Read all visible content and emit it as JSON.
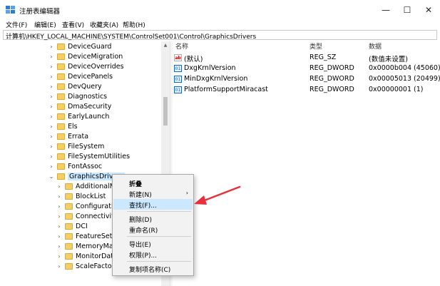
{
  "window": {
    "title": "注册表编辑器",
    "minimize": "—",
    "maximize": "☐",
    "close": "✕"
  },
  "menu": [
    "文件(F)",
    "编辑(E)",
    "查看(V)",
    "收藏夹(A)",
    "帮助(H)"
  ],
  "address": "计算机\\HKEY_LOCAL_MACHINE\\SYSTEM\\ControlSet001\\Control\\GraphicsDrivers",
  "tree": [
    {
      "label": "DeviceGuard",
      "level": 0
    },
    {
      "label": "DeviceMigration",
      "level": 0
    },
    {
      "label": "DeviceOverrides",
      "level": 0
    },
    {
      "label": "DevicePanels",
      "level": 0
    },
    {
      "label": "DevQuery",
      "level": 0
    },
    {
      "label": "Diagnostics",
      "level": 0
    },
    {
      "label": "DmaSecurity",
      "level": 0
    },
    {
      "label": "EarlyLaunch",
      "level": 0
    },
    {
      "label": "Els",
      "level": 0
    },
    {
      "label": "Errata",
      "level": 0
    },
    {
      "label": "FileSystem",
      "level": 0
    },
    {
      "label": "FileSystemUtilities",
      "level": 0
    },
    {
      "label": "FontAssoc",
      "level": 0
    },
    {
      "label": "GraphicsDrivers",
      "level": 0,
      "expanded": true,
      "selected": true
    },
    {
      "label": "AdditionalMo",
      "level": 1
    },
    {
      "label": "BlockList",
      "level": 1
    },
    {
      "label": "Configuration",
      "level": 1
    },
    {
      "label": "Connectivity",
      "level": 1
    },
    {
      "label": "DCI",
      "level": 1
    },
    {
      "label": "FeatureSetUs",
      "level": 1
    },
    {
      "label": "MemoryMan",
      "level": 1
    },
    {
      "label": "MonitorDataS",
      "level": 1
    },
    {
      "label": "ScaleFactors",
      "level": 1
    }
  ],
  "columns": {
    "name": "名称",
    "type": "类型",
    "data": "数据"
  },
  "values": [
    {
      "name": "(默认)",
      "type": "REG_SZ",
      "data": "(数值未设置)",
      "icon": "string-value-icon"
    },
    {
      "name": "DxgKrnlVersion",
      "type": "REG_DWORD",
      "data": "0x0000b004 (45060)",
      "icon": "binary-value-icon"
    },
    {
      "name": "MinDxgKrnlVersion",
      "type": "REG_DWORD",
      "data": "0x00005013 (20499)",
      "icon": "binary-value-icon"
    },
    {
      "name": "PlatformSupportMiracast",
      "type": "REG_DWORD",
      "data": "0x00000001 (1)",
      "icon": "binary-value-icon"
    }
  ],
  "context_menu": [
    {
      "label": "折叠",
      "bold": true
    },
    {
      "label": "新建(N)",
      "submenu": true
    },
    {
      "label": "查找(F)...",
      "hover": true
    },
    {
      "separator": true
    },
    {
      "label": "删除(D)"
    },
    {
      "label": "重命名(R)"
    },
    {
      "separator": true
    },
    {
      "label": "导出(E)"
    },
    {
      "label": "权限(P)..."
    },
    {
      "separator": true
    },
    {
      "label": "复制项名称(C)"
    }
  ],
  "colors": {
    "selection": "#cce8ff",
    "annotation_arrow": "#e8303a",
    "folder": "#f4cf66"
  }
}
